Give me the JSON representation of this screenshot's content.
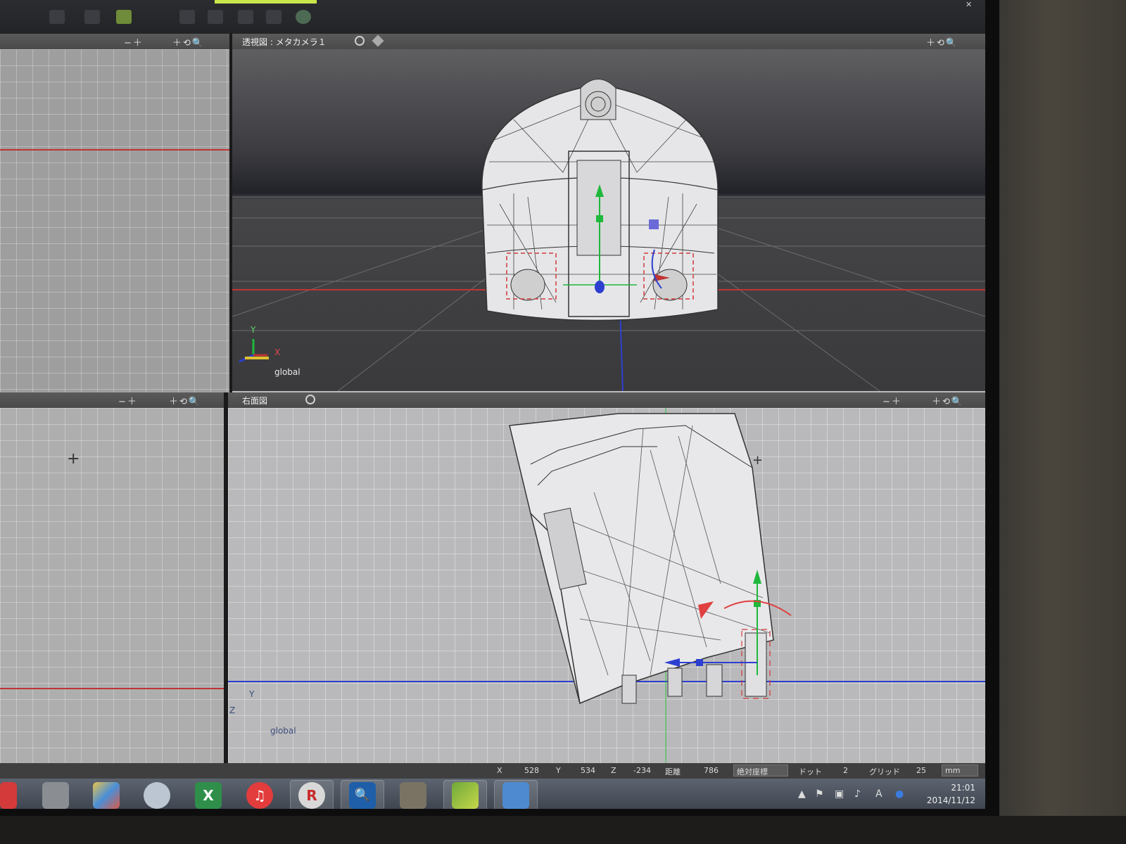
{
  "viewport_top": {
    "zoom_controls": "−＋",
    "nav_controls": "＋⟲🔍",
    "title": "透視図 : メタカメラ１",
    "axis_y": "Y",
    "axis_x": "X",
    "coord_mode": "global"
  },
  "viewport_bottom": {
    "zoom_controls": "−＋",
    "nav_controls": "＋⟲🔍",
    "title": "右面図",
    "axis_y": "Y",
    "axis_z": "Z",
    "coord_mode": "global"
  },
  "viewport_left": {
    "zoom_controls": "−＋",
    "nav_controls": "＋⟲🔍"
  },
  "status_bar": {
    "x_label": "X",
    "x_value": "528",
    "y_label": "Y",
    "y_value": "534",
    "z_label": "Z",
    "z_value": "-234",
    "distance_label": "距離",
    "distance_value": "786",
    "coord_mode": "絶対座標",
    "dot_label": "ドット",
    "dot_value": "2",
    "grid_label": "グリッド",
    "grid_value": "25",
    "unit": "mm"
  },
  "taskbar": {
    "time": "21:01",
    "date": "2014/11/12",
    "apps": [
      "close-app-icon",
      "system-tool-icon",
      "paint-icon",
      "browser-icon",
      "excel-icon",
      "itunes-icon",
      "rakuten-icon",
      "amazon-search-icon",
      "gimp-icon",
      "pen-app-icon",
      "calculator-icon"
    ]
  },
  "colors": {
    "accent_green": "#c9e64a",
    "axis_red": "#c03434",
    "axis_blue": "#2d3fd0",
    "axis_green": "#1fb83b"
  }
}
